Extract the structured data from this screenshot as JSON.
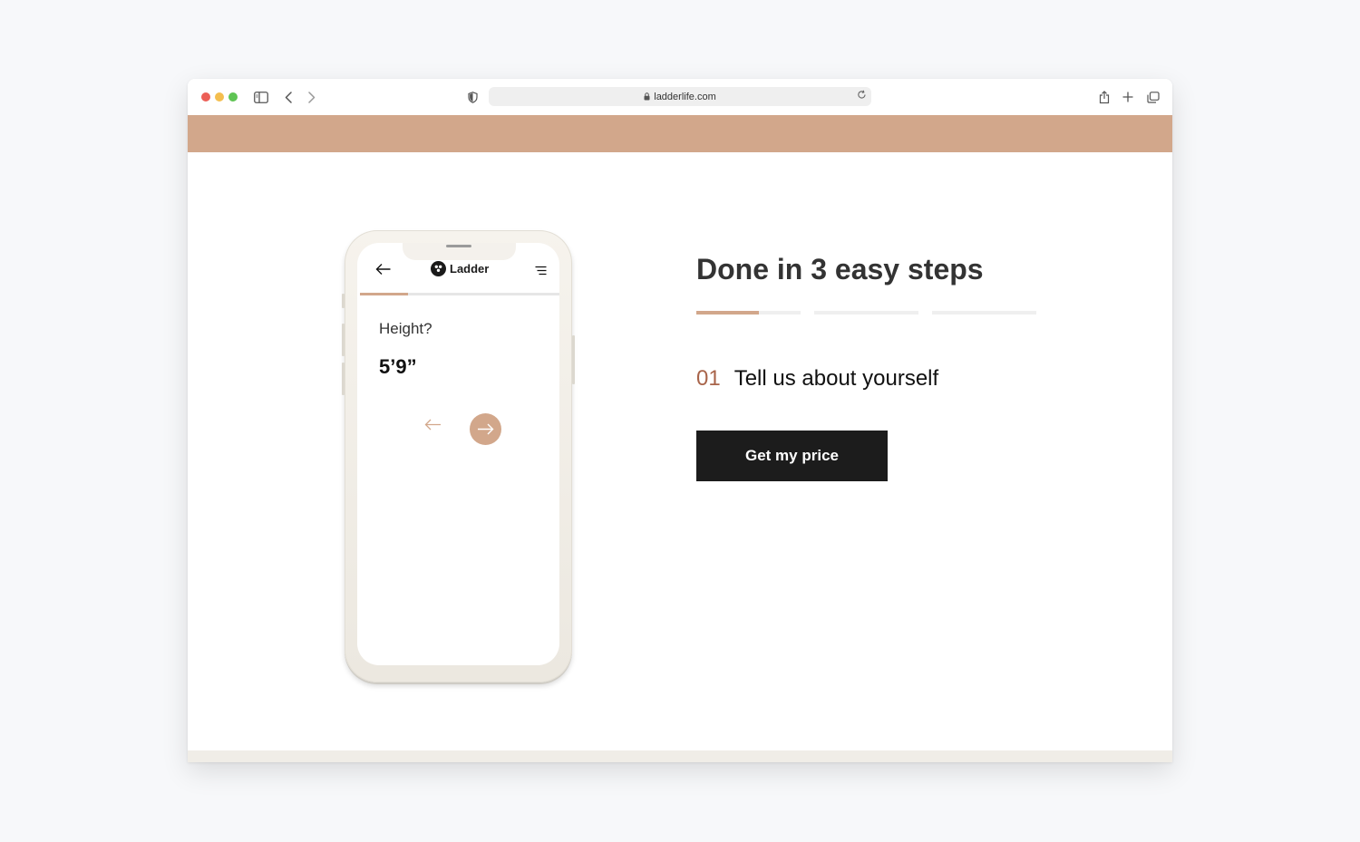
{
  "browser": {
    "url": "ladderlife.com",
    "icons": [
      "sidebar-icon",
      "back-icon",
      "forward-icon",
      "shield-icon",
      "lock-icon",
      "reload-icon",
      "share-icon",
      "new-tab-icon",
      "tabs-overview-icon"
    ]
  },
  "phone": {
    "brand": "Ladder",
    "question": "Height?",
    "answer": "5’9”",
    "progress": 0.24
  },
  "section": {
    "heading": "Done in 3 easy steps",
    "steps_total": 3,
    "active_step_progress": 0.6,
    "step_number": "01",
    "step_title": "Tell us about yourself",
    "cta_label": "Get my price"
  },
  "colors": {
    "accent": "#d2a78b",
    "step_number": "#a8644a",
    "cta_bg": "#1c1c1c"
  }
}
